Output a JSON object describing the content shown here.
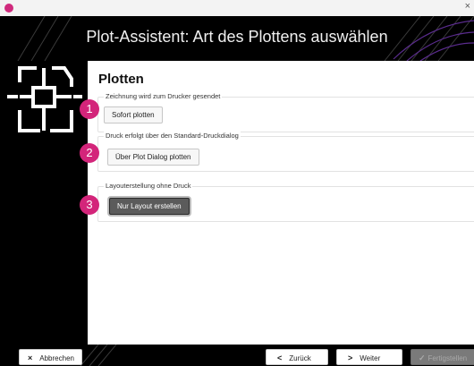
{
  "window": {
    "close_glyph": "×",
    "icon": "app-logo-icon"
  },
  "header": {
    "title": "Plot-Assistent: Art des Plottens auswählen"
  },
  "main": {
    "title": "Plotten",
    "groups": [
      {
        "label": "Zeichnung wird zum Drucker gesendet",
        "button": "Sofort plotten",
        "badge": "1"
      },
      {
        "label": "Druck erfolgt über den Standard-Druckdialog",
        "button": "Über Plot Dialog plotten",
        "badge": "2"
      },
      {
        "label": "Layouterstellung ohne Druck",
        "button": "Nur Layout erstellen",
        "badge": "3"
      }
    ]
  },
  "footer": {
    "cancel": {
      "label": "Abbrechen",
      "icon": "×"
    },
    "back": {
      "label": "Zurück",
      "icon": "<"
    },
    "next": {
      "label": "Weiter",
      "icon": ">"
    },
    "finish": {
      "label": "Fertigstellen",
      "icon": "✓"
    }
  },
  "colors": {
    "accent": "#d3257a",
    "header_bg": "#000000"
  }
}
